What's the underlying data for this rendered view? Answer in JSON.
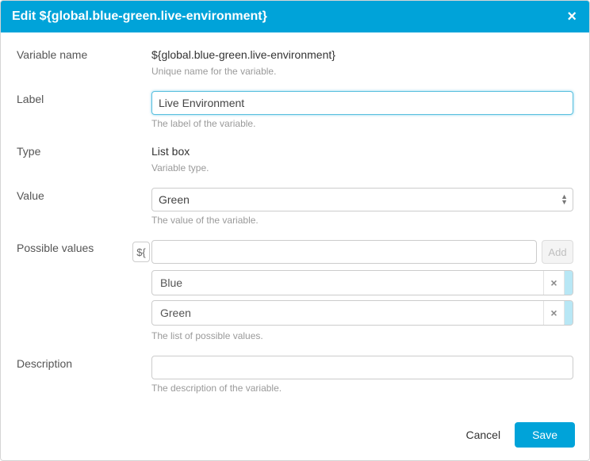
{
  "dialog": {
    "title": "Edit ${global.blue-green.live-environment}",
    "close_glyph": "×"
  },
  "fields": {
    "variable_name": {
      "label": "Variable name",
      "value": "${global.blue-green.live-environment}",
      "hint": "Unique name for the variable."
    },
    "label_field": {
      "label": "Label",
      "value": "Live Environment",
      "hint": "The label of the variable."
    },
    "type": {
      "label": "Type",
      "value": "List box",
      "hint": "Variable type."
    },
    "value": {
      "label": "Value",
      "selected": "Green",
      "hint": "The value of the variable."
    },
    "possible_values": {
      "label": "Possible values",
      "token": "${",
      "add_label": "Add",
      "new_value": "",
      "items": [
        "Blue",
        "Green"
      ],
      "remove_glyph": "×",
      "hint": "The list of possible values."
    },
    "description": {
      "label": "Description",
      "value": "",
      "hint": "The description of the variable."
    }
  },
  "footer": {
    "cancel": "Cancel",
    "save": "Save"
  }
}
